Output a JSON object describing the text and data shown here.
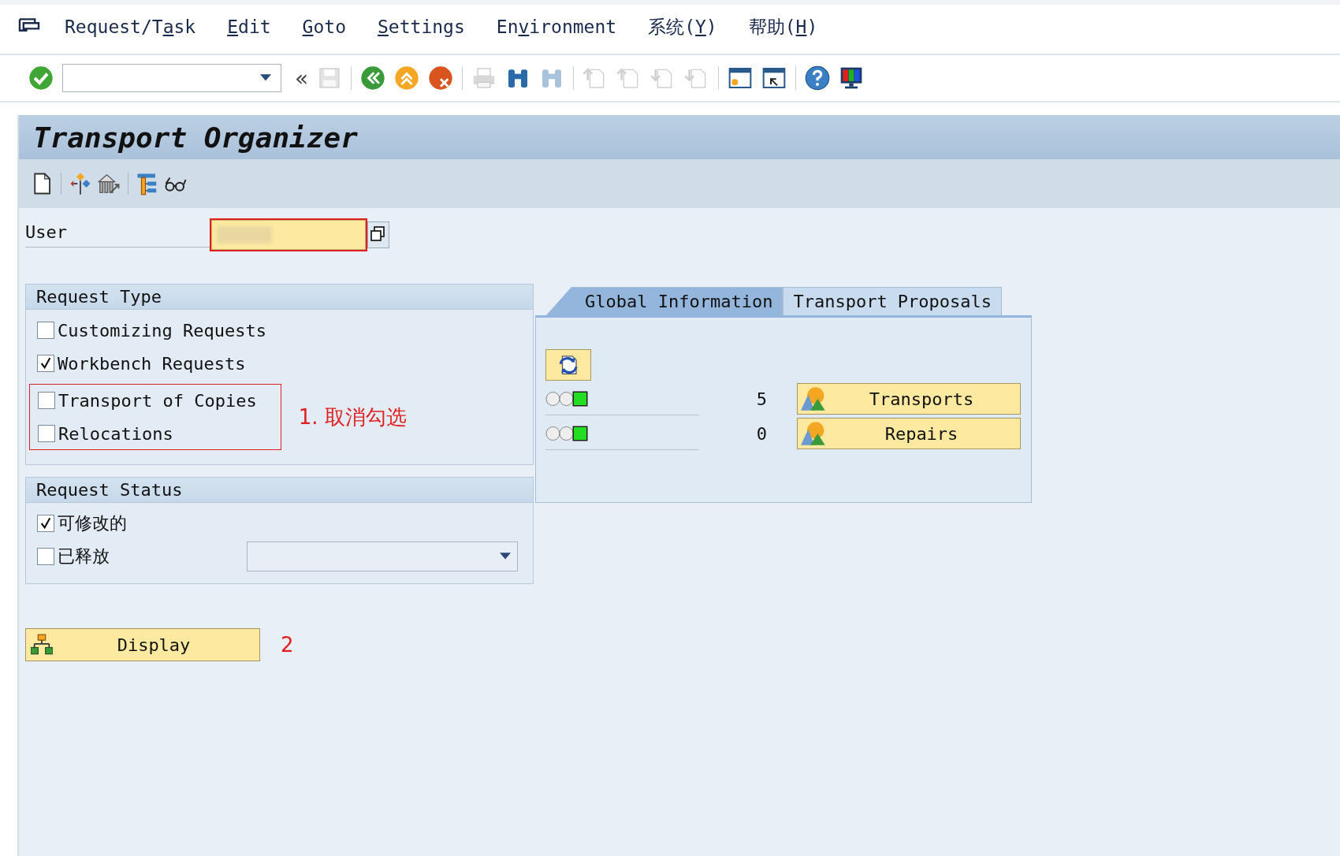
{
  "menu": [
    {
      "before": "Request/T",
      "access_key": "a",
      "after": "sk"
    },
    {
      "access_key": "E",
      "after": "dit"
    },
    {
      "access_key": "G",
      "after": "oto"
    },
    {
      "access_key": "S",
      "after": "ettings"
    },
    {
      "before": "En",
      "access_key": "v",
      "after": "ironment"
    },
    {
      "before": "系统(",
      "access_key": "Y",
      "after": ")"
    },
    {
      "before": "帮助(",
      "access_key": "H",
      "after": ")"
    }
  ],
  "toolbar": [
    {
      "kind": "enter"
    },
    {
      "kind": "command"
    },
    {
      "kind": "collapse",
      "label": "«"
    },
    {
      "kind": "save",
      "disabled": true
    },
    {
      "kind": "sep"
    },
    {
      "kind": "back",
      "disabled": false
    },
    {
      "kind": "exit",
      "disabled": false
    },
    {
      "kind": "cancel",
      "disabled": false
    },
    {
      "kind": "sep"
    },
    {
      "kind": "print",
      "disabled": true
    },
    {
      "kind": "find",
      "disabled": false
    },
    {
      "kind": "findnext",
      "disabled": true
    },
    {
      "kind": "sep"
    },
    {
      "kind": "first",
      "disabled": true
    },
    {
      "kind": "prev",
      "disabled": true
    },
    {
      "kind": "next",
      "disabled": true
    },
    {
      "kind": "last",
      "disabled": true
    },
    {
      "kind": "sep"
    },
    {
      "kind": "newsession",
      "disabled": false
    },
    {
      "kind": "shortcut",
      "disabled": false
    },
    {
      "kind": "sep"
    },
    {
      "kind": "help",
      "disabled": false
    },
    {
      "kind": "layout",
      "disabled": false
    }
  ],
  "title": "Transport Organizer",
  "app_toolbar": [
    {
      "kind": "new"
    },
    {
      "kind": "sep"
    },
    {
      "kind": "diamond"
    },
    {
      "kind": "building"
    },
    {
      "kind": "sep"
    },
    {
      "kind": "hierarchy"
    },
    {
      "kind": "glasses"
    }
  ],
  "user": {
    "label": "User",
    "redacted": true,
    "required": true
  },
  "request_type": {
    "title": "Request Type",
    "options": [
      {
        "label": "Customizing Requests",
        "checked": false
      },
      {
        "label": "Workbench Requests",
        "checked": true
      }
    ],
    "marked_options": {
      "note": "1. 取消勾选",
      "items": [
        {
          "label": "Transport of Copies",
          "checked": false
        },
        {
          "label": "Relocations",
          "checked": false
        }
      ]
    }
  },
  "request_status": {
    "title": "Request Status",
    "options": [
      {
        "label": "可修改的",
        "checked": true,
        "dropdown": false
      },
      {
        "label": "已释放",
        "checked": false,
        "dropdown": true
      }
    ]
  },
  "display_button": {
    "label": "Display",
    "note": "2"
  },
  "tabs": [
    {
      "label": "Global Information",
      "selected": true
    },
    {
      "label": "Transport Proposals",
      "selected": false
    }
  ],
  "global_info": {
    "rows": [
      {
        "color": "#22dd22",
        "count": "5",
        "button": "Transports"
      },
      {
        "color": "#22dd22",
        "count": "0",
        "button": "Repairs"
      }
    ]
  }
}
